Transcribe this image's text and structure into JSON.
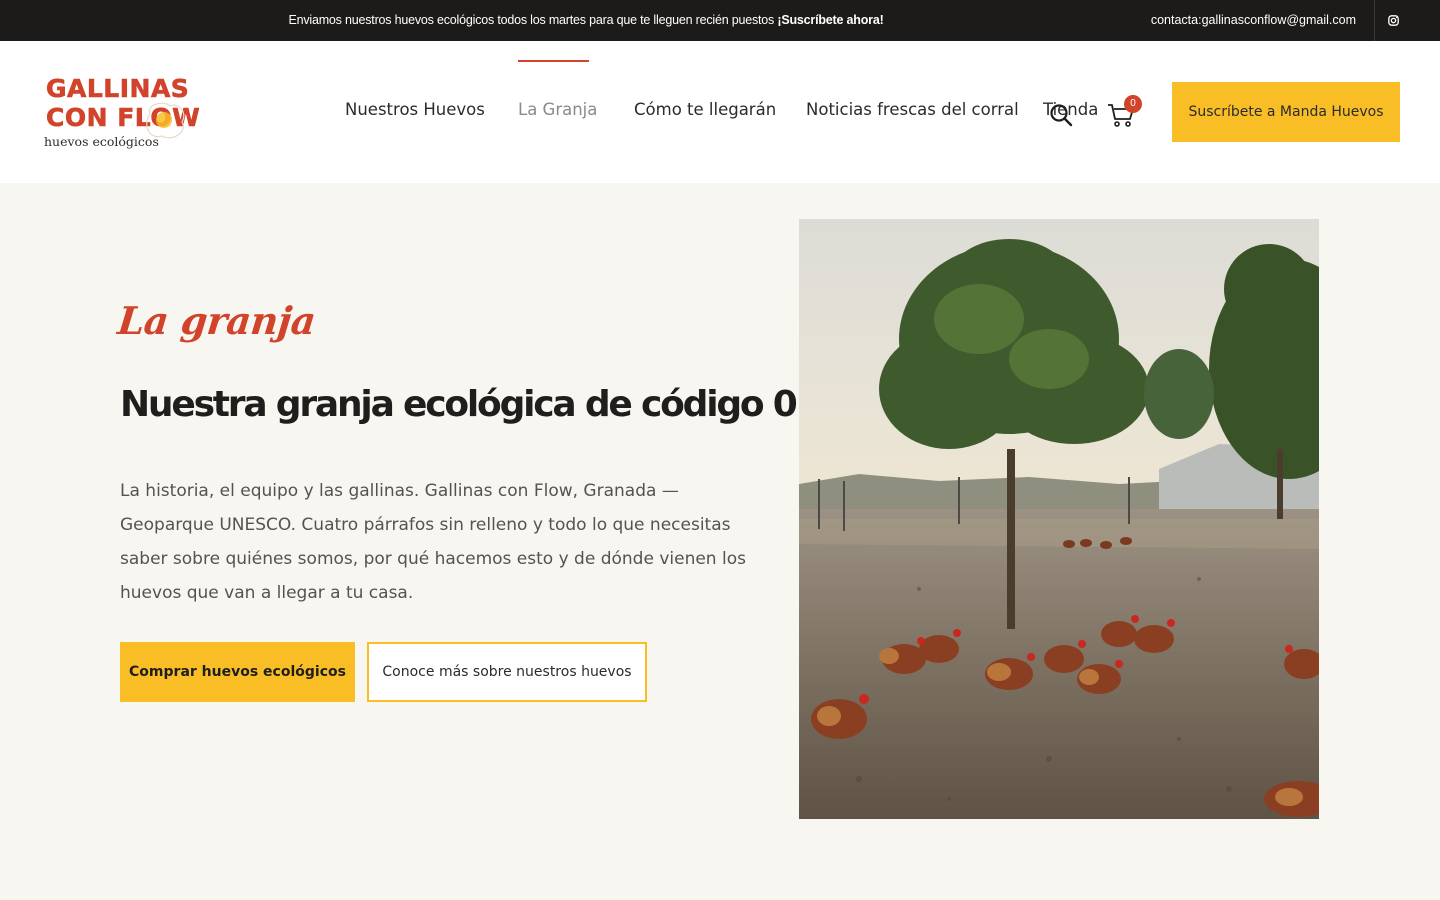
{
  "topbar": {
    "promo_text": "Enviamos nuestros huevos ecológicos todos los martes para que te lleguen recién puestos ",
    "promo_link": "¡Suscríbete ahora!",
    "email": "contacta:gallinasconflow@gmail.com",
    "social_icon": "instagram-icon"
  },
  "logo": {
    "line1": "GALLINAS",
    "line2": "CON FLOW",
    "tagline": "huevos ecológicos",
    "color": "#d1432a"
  },
  "nav": {
    "items": [
      {
        "label": "Nuestros Huevos",
        "active": false
      },
      {
        "label": "La Granja",
        "active": true
      },
      {
        "label": "Cómo te llegarán",
        "active": false
      },
      {
        "label": "Noticias frescas del corral",
        "active": false
      },
      {
        "label": "Tienda",
        "active": false
      }
    ],
    "cart_count": "0",
    "subscribe_label": "Suscríbete a Manda Huevos"
  },
  "hero": {
    "kicker": "La granja",
    "title": "Nuestra granja ecológica de código 0",
    "text": "La historia, el equipo y las gallinas. Gallinas con Flow, Granada — Geoparque UNESCO. Cuatro párrafos sin relleno y todo lo que necesitas saber sobre quiénes somos, por qué hacemos esto y de dónde vienen los huevos que van a llegar a tu casa.",
    "primary_button": "Comprar huevos ecológicos",
    "secondary_button": "Conoce más sobre nuestros huevos"
  },
  "colors": {
    "accent": "#f9be26",
    "brand_red": "#d1432a",
    "background": "#f8f6f0",
    "topbar": "#1c1b19"
  }
}
